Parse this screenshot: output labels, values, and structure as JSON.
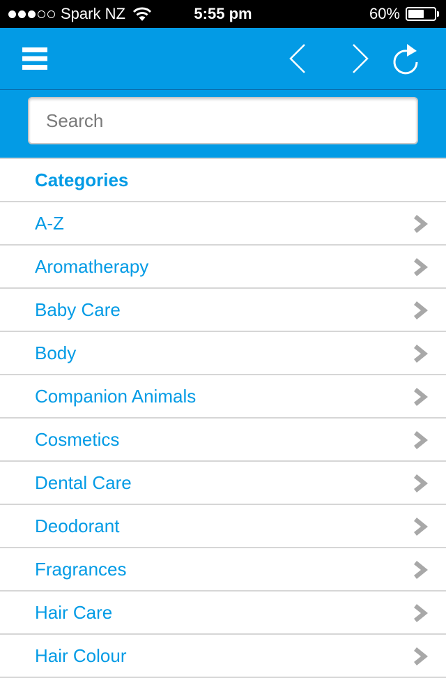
{
  "status_bar": {
    "signal_full": 3,
    "signal_empty": 2,
    "carrier": "Spark NZ",
    "wifi_icon": "wifi-icon",
    "time": "5:55 pm",
    "battery_percent_label": "60%",
    "battery_level": 0.6
  },
  "navbar": {
    "menu_icon": "hamburger-menu-icon",
    "back_icon": "chevron-left-icon",
    "forward_icon": "chevron-right-icon",
    "refresh_icon": "refresh-icon",
    "background_color": "#039be5"
  },
  "search": {
    "placeholder": "Search",
    "value": ""
  },
  "categories": {
    "header": "Categories",
    "accent_color": "#039be5",
    "items": [
      {
        "label": "A-Z"
      },
      {
        "label": "Aromatherapy"
      },
      {
        "label": "Baby Care"
      },
      {
        "label": "Body"
      },
      {
        "label": "Companion Animals"
      },
      {
        "label": "Cosmetics"
      },
      {
        "label": "Dental Care"
      },
      {
        "label": "Deodorant"
      },
      {
        "label": "Fragrances"
      },
      {
        "label": "Hair Care"
      },
      {
        "label": "Hair Colour"
      }
    ]
  }
}
